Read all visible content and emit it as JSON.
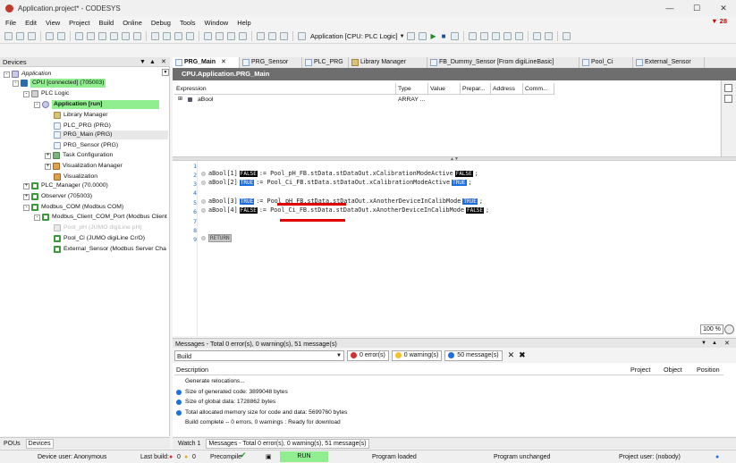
{
  "window": {
    "title": "Application.project* - CODESYS",
    "notification_count": "28"
  },
  "menu": [
    "File",
    "Edit",
    "View",
    "Project",
    "Build",
    "Online",
    "Debug",
    "Tools",
    "Window",
    "Help"
  ],
  "toolbar": {
    "context_label": "Application [CPU: PLC Logic]"
  },
  "devices": {
    "header": "Devices",
    "tree": [
      {
        "label": "Application",
        "level": 0,
        "icon": "app-icon",
        "italic": true
      },
      {
        "label": "CPU [connected] (705003)",
        "level": 1,
        "icon": "cpu-icon",
        "highlight": "green"
      },
      {
        "label": "PLC Logic",
        "level": 2,
        "icon": "plc-icon"
      },
      {
        "label": "Application [run]",
        "level": 3,
        "icon": "application-icon",
        "highlight": "green",
        "bold": true
      },
      {
        "label": "Library Manager",
        "level": 4,
        "icon": "library-icon"
      },
      {
        "label": "PLC_PRG (PRG)",
        "level": 4,
        "icon": "pou-icon"
      },
      {
        "label": "PRG_Main (PRG)",
        "level": 4,
        "icon": "pou-icon",
        "highlight": "gray"
      },
      {
        "label": "PRG_Sensor (PRG)",
        "level": 4,
        "icon": "pou-icon"
      },
      {
        "label": "Task Configuration",
        "level": 4,
        "icon": "task-icon"
      },
      {
        "label": "Visualization Manager",
        "level": 4,
        "icon": "visualization-icon"
      },
      {
        "label": "Visualization",
        "level": 4,
        "icon": "visualization-icon"
      },
      {
        "label": "PLC_Manager (70.0000)",
        "level": 1,
        "icon": "network-icon"
      },
      {
        "label": "Observer (705003)",
        "level": 1,
        "icon": "network-icon"
      },
      {
        "label": "Modbus_COM (Modbus COM)",
        "level": 1,
        "icon": "network-icon"
      },
      {
        "label": "Modbus_Client_COM_Port (Modbus Client",
        "level": 2,
        "icon": "network-icon"
      },
      {
        "label": "Pool_pH (JUMO digiLine pH)",
        "level": 3,
        "icon": "device-icon",
        "disabled": true
      },
      {
        "label": "Pool_Ci (JUMO digiLine Cr/O)",
        "level": 3,
        "icon": "network-icon"
      },
      {
        "label": "External_Sensor (Modbus Server Cha",
        "level": 3,
        "icon": "network-icon"
      }
    ],
    "bottom_tabs": [
      "POUs",
      "Devices"
    ]
  },
  "editor": {
    "tabs": [
      "PRG_Main",
      "PRG_Sensor",
      "PLC_PRG",
      "Library Manager",
      "FB_Dummy_Sensor [From digiLineBasic]",
      "Pool_Ci",
      "External_Sensor"
    ],
    "header": "CPU.Application.PRG_Main",
    "watch": {
      "columns": [
        "Expression",
        "Type",
        "Value",
        "Prepar...",
        "Address",
        "Comm..."
      ],
      "rows": [
        {
          "expression": "aBool",
          "type": "ARRAY ...",
          "value": "",
          "prepared": "",
          "address": "",
          "comment": ""
        }
      ]
    },
    "code_lines": [
      {
        "n": "1",
        "parts": []
      },
      {
        "n": "2",
        "parts": [
          "aBool[1]",
          "FALSE",
          ":= Pool_pH_FB.stData.stDataOut.xCalibrationModeActive",
          "FALSE",
          ";"
        ]
      },
      {
        "n": "3",
        "parts": [
          "aBool[2]",
          "TRUE",
          ":= Pool_Ci_FB.stData.stDataOut.xCalibrationModeActive",
          "TRUE",
          ";"
        ]
      },
      {
        "n": "4",
        "parts": []
      },
      {
        "n": "5",
        "parts": [
          "aBool[3]",
          "TRUE",
          ":= Pool_pH_FB.stData.stDataOut.xAnotherDeviceInCalibMode",
          "TRUE",
          ";"
        ]
      },
      {
        "n": "6",
        "parts": [
          "aBool[4]",
          "FALSE",
          ":= Pool_Ci_FB.stData.stDataOut.xAnotherDeviceInCalibMode",
          "FALSE",
          ";"
        ]
      },
      {
        "n": "7",
        "parts": []
      },
      {
        "n": "8",
        "parts": []
      },
      {
        "n": "9",
        "parts": [
          "RETURN"
        ]
      }
    ],
    "zoom": "100 %"
  },
  "messages": {
    "header": "Messages - Total 0 error(s), 0 warning(s), 51 message(s)",
    "source": "Build",
    "filters": {
      "errors": "0 error(s)",
      "warnings": "0 warning(s)",
      "messages": "50 message(s)"
    },
    "columns": [
      "Description",
      "Project",
      "Object",
      "Position"
    ],
    "rows": [
      {
        "icon": "none",
        "text": "Generate relocations..."
      },
      {
        "icon": "info-icon",
        "text": "Size of generated code: 3899048 bytes"
      },
      {
        "icon": "info-icon",
        "text": "Size of global data: 1728862 bytes"
      },
      {
        "icon": "info-icon",
        "text": "Total allocated memory size for code and data: 5699760 bytes"
      },
      {
        "icon": "none",
        "text": "Build complete -- 0 errors, 0 warnings : Ready for download"
      }
    ],
    "bottom_tabs": [
      "Watch 1",
      "Messages - Total 0 error(s), 0 warning(s), 51 message(s)"
    ]
  },
  "statusbar": {
    "device_user": "Device user: Anonymous",
    "last_build": "Last build:",
    "last_build_errors": "0",
    "last_build_warnings": "0",
    "precompile": "Precompile",
    "run_state": "RUN",
    "program_state": "Program loaded",
    "program_change": "Program unchanged",
    "project_user": "Project user: (nobody)"
  },
  "colors": {
    "run_green": "#90ee90",
    "true_blue": "#1b6fe0",
    "false_black": "#000000",
    "underline_red": "#e00000"
  }
}
